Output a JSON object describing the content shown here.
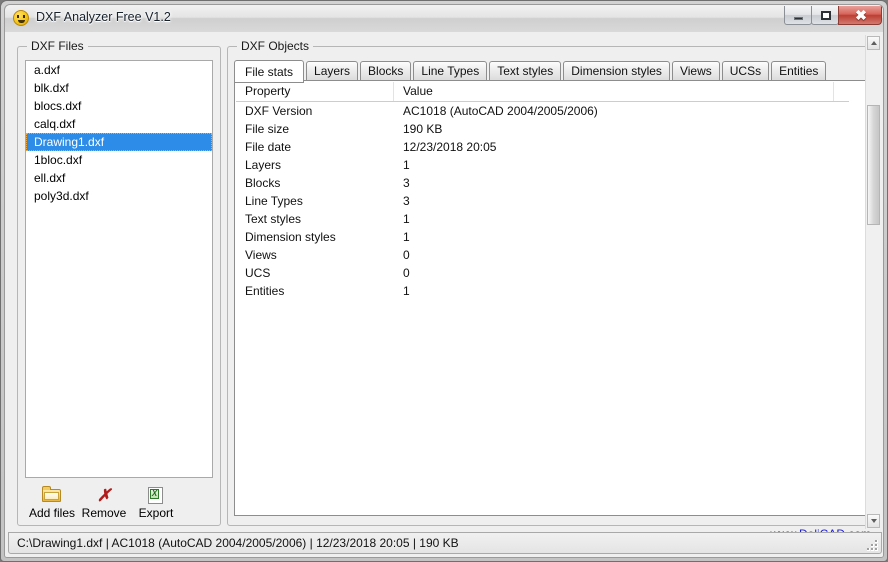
{
  "window": {
    "title": "DXF Analyzer Free V1.2",
    "icon": "smiley-icon",
    "controls": {
      "minimize": "–",
      "maximize": "□",
      "close": "✖"
    }
  },
  "files_panel": {
    "title": "DXF Files",
    "items": [
      {
        "label": "a.dxf",
        "selected": false
      },
      {
        "label": "blk.dxf",
        "selected": false
      },
      {
        "label": "blocs.dxf",
        "selected": false
      },
      {
        "label": "calq.dxf",
        "selected": false
      },
      {
        "label": "Drawing1.dxf",
        "selected": true
      },
      {
        "label": "1bloc.dxf",
        "selected": false
      },
      {
        "label": "ell.dxf",
        "selected": false
      },
      {
        "label": "poly3d.dxf",
        "selected": false
      }
    ],
    "toolbar": [
      {
        "label": "Add files",
        "icon": "folder-icon"
      },
      {
        "label": "Remove",
        "icon": "red-x-icon"
      },
      {
        "label": "Export",
        "icon": "export-document-icon"
      }
    ]
  },
  "objects_panel": {
    "title": "DXF Objects",
    "tabs": [
      {
        "label": "File stats",
        "active": true
      },
      {
        "label": "Layers",
        "active": false
      },
      {
        "label": "Blocks",
        "active": false
      },
      {
        "label": "Line Types",
        "active": false
      },
      {
        "label": "Text styles",
        "active": false
      },
      {
        "label": "Dimension styles",
        "active": false
      },
      {
        "label": "Views",
        "active": false
      },
      {
        "label": "UCSs",
        "active": false
      },
      {
        "label": "Entities",
        "active": false
      }
    ],
    "table": {
      "headers": [
        "Property",
        "Value"
      ],
      "rows": [
        [
          "DXF Version",
          "AC1018 (AutoCAD 2004/2005/2006)"
        ],
        [
          "File size",
          "190 KB"
        ],
        [
          "File date",
          "12/23/2018 20:05"
        ],
        [
          "Layers",
          "1"
        ],
        [
          "Blocks",
          "3"
        ],
        [
          "Line Types",
          "3"
        ],
        [
          "Text styles",
          "1"
        ],
        [
          "Dimension styles",
          "1"
        ],
        [
          "Views",
          "0"
        ],
        [
          "UCS",
          "0"
        ],
        [
          "Entities",
          "1"
        ]
      ]
    }
  },
  "link": {
    "label": "www.DeliCAD.com"
  },
  "statusbar": {
    "text": "C:\\Drawing1.dxf | AC1018 (AutoCAD 2004/2005/2006) | 12/23/2018 20:05 | 190 KB"
  },
  "colors": {
    "selection_blue": "#2c8ce8",
    "link_blue": "#1a1ad6",
    "close_red": "#bb3e32"
  }
}
